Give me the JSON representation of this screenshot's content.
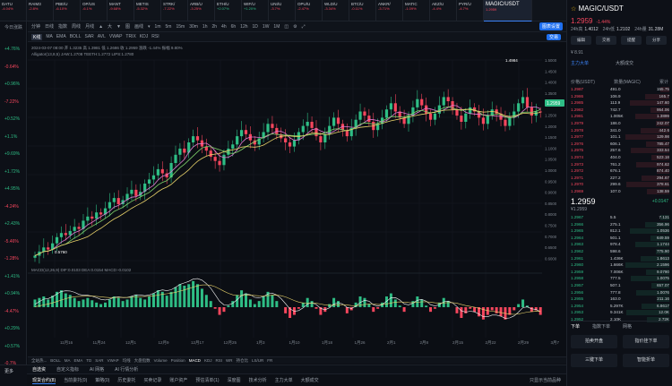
{
  "tickers": [
    {
      "name": "DATU",
      "value": "0.04452229",
      "change": "-4.04%",
      "dir": "dn"
    },
    {
      "name": "RAIM3",
      "value": "0.074105",
      "change": "-2.8%",
      "dir": "dn"
    },
    {
      "name": "PBE/U",
      "value": "0.7987",
      "change": "-6.10%",
      "dir": "dn"
    },
    {
      "name": "OP/US",
      "value": "4.6135",
      "change": "-6.1%",
      "dir": "dn"
    },
    {
      "name": "MANT",
      "value": "5.460",
      "change": "-9.68%",
      "dir": "dn"
    },
    {
      "name": "METIS",
      "value": "46.44",
      "change": "-5.32%",
      "dir": "dn"
    },
    {
      "name": "STRK/",
      "value": "2.044",
      "change": "-7.22%",
      "dir": "dn"
    },
    {
      "name": "ARB/U",
      "value": "1.924",
      "change": "-3.25%",
      "dir": "dn"
    },
    {
      "name": "ETH/U",
      "value": "5.41",
      "change": "+2.07%",
      "dir": "up"
    },
    {
      "name": "WIF/U",
      "value": "2.8046",
      "change": "+1.20%",
      "dir": "up"
    },
    {
      "name": "UNI/U",
      "value": "10.77",
      "change": "-3.7%",
      "dir": "dn"
    },
    {
      "name": "OPU/U",
      "value": "0.7654",
      "change": "-2.47%",
      "dir": "dn"
    },
    {
      "name": "WLD/U",
      "value": "7.397",
      "change": "-3.34%",
      "dir": "dn"
    },
    {
      "name": "BTC/U",
      "value": "68871.04",
      "change": "-0.11%",
      "dir": "dn"
    },
    {
      "name": "ANKR/",
      "value": "0.05914",
      "change": "-3.71%",
      "dir": "dn"
    },
    {
      "name": "MATIC",
      "value": "1.1036",
      "change": "-1.09%",
      "dir": "dn"
    },
    {
      "name": "AEZ/U",
      "value": "12.6236",
      "change": "-4.4%",
      "dir": "dn"
    },
    {
      "name": "PYR/U",
      "value": "7.145",
      "change": "-4.7%",
      "dir": "dn"
    }
  ],
  "active_ticker": {
    "name": "MAGIC/USDT",
    "value": "1.2959",
    "change": "-1.44%"
  },
  "left_changes": [
    {
      "v": "+4.76%",
      "dir": "up"
    },
    {
      "v": "-0.64%",
      "dir": "dn"
    },
    {
      "v": "+0.96%",
      "dir": "up"
    },
    {
      "v": "-7.22%",
      "dir": "dn"
    },
    {
      "v": "+0.52%",
      "dir": "up"
    },
    {
      "v": "+1.1%",
      "dir": "up"
    },
    {
      "v": "+9.69%",
      "dir": "up"
    },
    {
      "v": "+1.72%",
      "dir": "up"
    },
    {
      "v": "+4.95%",
      "dir": "up"
    },
    {
      "v": "-4.24%",
      "dir": "dn"
    },
    {
      "v": "+2.43%",
      "dir": "up"
    },
    {
      "v": "-5.46%",
      "dir": "dn"
    },
    {
      "v": "-1.28%",
      "dir": "dn"
    },
    {
      "v": "+1.41%",
      "dir": "up"
    },
    {
      "v": "+0.94%",
      "dir": "up"
    },
    {
      "v": "-4.47%",
      "dir": "dn"
    },
    {
      "v": "+0.29%",
      "dir": "up"
    },
    {
      "v": "+0.57%",
      "dir": "up"
    },
    {
      "v": "-0.7%",
      "dir": "dn"
    }
  ],
  "left_header": "今日涨跌",
  "toolbar1": [
    "分钟",
    "日线",
    "指数",
    "周线",
    "月线",
    "▲",
    "大",
    "▼",
    "图",
    "画线",
    "▾",
    "1m",
    "5m",
    "15m",
    "30m",
    "1h",
    "2h",
    "4h",
    "6h",
    "12h",
    "1D",
    "1W",
    "1M",
    "◫",
    "⚙",
    "⤢"
  ],
  "toolbar1_right": "图表设置",
  "toolbar2": [
    "K线",
    "MA",
    "EMA",
    "BOLL",
    "SAR",
    "AVL",
    "VWAP",
    "TRIX",
    "KDJ",
    "RSI"
  ],
  "toolbar2_primary": "交易",
  "ohlc_line": "2024-03-07 08:00  开 1.3235  高 1.3981  低 1.2686  收 1.2959  涨跌 -1.44%  振幅 9.80%",
  "alligator_line": "Alligator(13,8,5)  JAW:1.2708  TEETH:1.2772  LIPS:1.2780",
  "macd_line": "MACD(12,26,9)  DIF:0.0103  DEA:0.0154  MACD:-0.0102",
  "price_labels": [
    "1.5000",
    "1.4500",
    "1.4000",
    "1.3500",
    "1.3000",
    "1.2500",
    "1.2000",
    "1.1500",
    "1.1000",
    "1.0500",
    "1.0000",
    "0.9500",
    "0.9000",
    "0.8500",
    "0.8000",
    "0.7500",
    "0.7000",
    "0.6500",
    "0.6000"
  ],
  "date_labels": [
    "11月16",
    "11月24",
    "12月1",
    "12月9",
    "12月17",
    "12月25",
    "1月3",
    "1月10",
    "1月18",
    "1月26",
    "2月1",
    "2月8",
    "2月15",
    "2月22",
    "2月29",
    "3月7"
  ],
  "high_label": "1.4984",
  "low_label": "0.5760",
  "current_price": "1.2959",
  "indicators": [
    "全站热...",
    "BOLL",
    "MA",
    "EMA",
    "TD",
    "SAR",
    "VWAP",
    "均线",
    "大盘指数",
    "Volume",
    "Position",
    "MACD",
    "KDJ",
    "RSI",
    "WR",
    "持仓比",
    "LS/UR",
    "FR"
  ],
  "indicator_active": "MACD",
  "bottom_tabs": [
    "自选资",
    "自定义指标",
    "AI 网格",
    "AI 行情分析"
  ],
  "bottom_tabs_active": "自选资",
  "order_tabs": [
    "现货合约(8)",
    "当前委托(0)",
    "策略(0)",
    "历史委托",
    "买卖记录",
    "账户资产",
    "预估清单(1)",
    "深度图",
    "技术分析",
    "主力大单",
    "大额成交"
  ],
  "order_tabs_active": "现货合约(8)",
  "bottom_status": "只显示当前品种",
  "sidebar_footer": "更多",
  "right": {
    "symbol": "MAGIC/USDT",
    "price": "1.2959",
    "change": "-1.44%",
    "change_val": "-0.0189",
    "stats": [
      {
        "k": "24h高",
        "v": "1.4012"
      },
      {
        "k": "24h低",
        "v": "1.2102"
      },
      {
        "k": "24h量",
        "v": "31.28M"
      }
    ],
    "buttons": [
      "编辑",
      "交易",
      "提醒",
      "分享"
    ],
    "row_label": "¥ 8.91",
    "tabs": [
      "主力大单",
      "大额成交"
    ],
    "tabs2": [
      "价格(USDT)",
      "数量(MAGIC)",
      "累计"
    ],
    "asks": [
      {
        "p": "1.2987",
        "q": "491.0",
        "t": "155.75"
      },
      {
        "p": "1.2986",
        "q": "106.9",
        "t": "165.7"
      },
      {
        "p": "1.2985",
        "q": "113.9",
        "t": "147.60"
      },
      {
        "p": "1.2982",
        "q": "742.7",
        "t": "954.06"
      },
      {
        "p": "1.2981",
        "q": "1.005K",
        "t": "1.3899"
      },
      {
        "p": "1.2979",
        "q": "186.0",
        "t": "242.07"
      },
      {
        "p": "1.2978",
        "q": "341.0",
        "t": "442.6"
      },
      {
        "p": "1.2977",
        "q": "101.1",
        "t": "129.98"
      },
      {
        "p": "1.2976",
        "q": "606.1",
        "t": "785.47"
      },
      {
        "p": "1.2975",
        "q": "257.6",
        "t": "333.54"
      },
      {
        "p": "1.2974",
        "q": "404.0",
        "t": "523.18"
      },
      {
        "p": "1.2973",
        "q": "761.2",
        "t": "974.62"
      },
      {
        "p": "1.2972",
        "q": "676.1",
        "t": "874.40"
      },
      {
        "p": "1.2971",
        "q": "227.2",
        "t": "294.67"
      },
      {
        "p": "1.2970",
        "q": "299.6",
        "t": "378.61"
      },
      {
        "p": "1.2969",
        "q": "107.0",
        "t": "138.59"
      }
    ],
    "mid_price": "1.2959",
    "mid_sub": "¥1.2959",
    "mid_right": "+0.0147",
    "bids": [
      {
        "p": "1.2967",
        "q": "5.5",
        "t": "7.131"
      },
      {
        "p": "1.2966",
        "q": "275.1",
        "t": "356.96"
      },
      {
        "p": "1.2965",
        "q": "812.1",
        "t": "1.0536"
      },
      {
        "p": "1.2964",
        "q": "501.1",
        "t": "649.59"
      },
      {
        "p": "1.2963",
        "q": "978.4",
        "t": "1.1744"
      },
      {
        "p": "1.2962",
        "q": "598.6",
        "t": "775.90"
      },
      {
        "p": "1.2961",
        "q": "1.436K",
        "t": "1.8613"
      },
      {
        "p": "1.2960",
        "q": "1.666K",
        "t": "2.1596"
      },
      {
        "p": "1.2959",
        "q": "7.006K",
        "t": "9.0790"
      },
      {
        "p": "1.2958",
        "q": "777.5",
        "t": "1.0075"
      },
      {
        "p": "1.2957",
        "q": "507.1",
        "t": "657.07"
      },
      {
        "p": "1.2956",
        "q": "777.8",
        "t": "1.0076"
      },
      {
        "p": "1.2955",
        "q": "163.0",
        "t": "211.16"
      },
      {
        "p": "1.2954",
        "q": "5.297K",
        "t": "6.8617"
      },
      {
        "p": "1.2953",
        "q": "9.341K",
        "t": "12.0K"
      },
      {
        "p": "1.2952",
        "q": "2.10K",
        "t": "2.72K"
      }
    ],
    "bottom_tabs": [
      "下单",
      "指数下单",
      "网格"
    ],
    "cards": [
      "拍卖开盘",
      "指价挂下单",
      "三键下单",
      "智能折单"
    ]
  },
  "chart_data": {
    "type": "candlestick",
    "ylim": [
      0.55,
      1.55
    ],
    "x_labels": [
      "11月16",
      "11月24",
      "12月1",
      "12月9",
      "12月17",
      "12月25",
      "1月3",
      "1月10",
      "1月18",
      "1月26",
      "2月1",
      "2月8",
      "2月15",
      "2月22",
      "2月29",
      "3月7"
    ],
    "close": [
      0.6,
      0.62,
      0.64,
      0.63,
      0.66,
      0.69,
      0.71,
      0.7,
      0.72,
      0.74,
      0.73,
      0.77,
      0.79,
      0.78,
      0.81,
      0.8,
      0.83,
      0.86,
      0.88,
      0.85,
      0.87,
      0.9,
      0.92,
      0.89,
      0.91,
      0.95,
      0.97,
      0.99,
      1.02,
      1.0,
      0.98,
      1.05,
      1.09,
      1.12,
      1.1,
      1.15,
      1.18,
      1.16,
      1.13,
      1.11,
      1.08,
      1.06,
      1.04,
      1.09,
      1.12,
      1.14,
      1.18,
      1.21,
      1.19,
      1.16,
      1.14,
      1.17,
      1.2,
      1.24,
      1.22,
      1.19,
      1.17,
      1.15,
      1.13,
      1.16,
      1.2,
      1.23,
      1.25,
      1.22,
      1.18,
      1.15,
      1.19,
      1.23,
      1.27,
      1.24,
      1.21,
      1.18,
      1.22,
      1.26,
      1.3,
      1.28,
      1.25,
      1.21,
      1.24,
      1.27,
      1.31,
      1.34,
      1.3,
      1.27,
      1.24,
      1.28,
      1.32,
      1.36,
      1.33,
      1.29,
      1.26,
      1.29,
      1.33,
      1.37,
      1.35,
      1.31,
      1.28,
      1.25,
      1.29,
      1.32,
      1.3,
      1.27,
      1.24,
      1.28,
      1.31,
      1.29,
      1.26,
      1.23,
      1.27,
      1.3,
      1.34,
      1.37,
      1.32,
      1.28,
      1.3,
      1.2959
    ],
    "macd_hist": [
      0.01,
      0.012,
      0.014,
      0.01,
      0.015,
      0.02,
      0.022,
      0.018,
      0.016,
      0.012,
      0.008,
      0.01,
      0.012,
      0.009,
      0.006,
      0.004,
      0.006,
      0.01,
      0.014,
      0.012,
      0.008,
      0.01,
      0.014,
      0.016,
      0.012,
      0.01,
      0.014,
      0.018,
      0.022,
      0.02,
      0.015,
      0.02,
      0.026,
      0.03,
      0.028,
      0.03,
      0.034,
      0.03,
      0.024,
      0.016,
      0.008,
      -0.002,
      -0.01,
      -0.006,
      0.002,
      0.008,
      0.016,
      0.022,
      0.018,
      0.01,
      0.004,
      0.008,
      0.014,
      0.02,
      0.016,
      0.008,
      0.0,
      -0.008,
      -0.014,
      -0.01,
      -0.002,
      0.006,
      0.012,
      0.008,
      -0.002,
      -0.01,
      -0.006,
      0.004,
      0.012,
      0.008,
      0.0,
      -0.008,
      -0.004,
      0.006,
      0.014,
      0.012,
      0.004,
      -0.006,
      -0.002,
      0.006,
      0.014,
      0.018,
      0.01,
      0.002,
      -0.006,
      0.0,
      0.008,
      0.014,
      0.01,
      0.002,
      -0.006,
      -0.002,
      0.006,
      0.012,
      0.008,
      0.0,
      -0.008,
      -0.014,
      -0.008,
      -0.002,
      -0.006,
      -0.012,
      -0.016,
      -0.01,
      -0.004,
      -0.008,
      -0.012,
      -0.016,
      -0.01,
      -0.004,
      0.004,
      0.01,
      0.002,
      -0.006,
      -0.004,
      -0.01
    ]
  }
}
